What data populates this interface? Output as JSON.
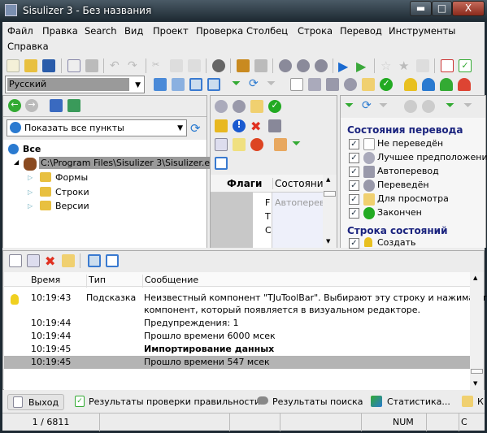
{
  "window": {
    "title": "Sisulizer 3 - Без названия",
    "minimize": "▬",
    "maximize": "□",
    "close": "X"
  },
  "menu": [
    "Файл",
    "Правка",
    "Search",
    "Вид",
    "Проект",
    "Проверка",
    "Столбец",
    "Строка",
    "Перевод",
    "Инструменты",
    "Справка"
  ],
  "language_combo": {
    "value": "Русский"
  },
  "project_tree": {
    "filter": "Показать все пункты",
    "root": "Все",
    "file": "C:\\Program Files\\Sisulizer 3\\Sisulizer.exe",
    "children": [
      "Формы",
      "Строки",
      "Версии"
    ]
  },
  "grid": {
    "headers": [
      "Флаги",
      "Состояние"
    ],
    "cells": [
      "F",
      "T",
      "C"
    ],
    "state_value": "Автоперевод"
  },
  "filter_panel": {
    "section1": "Состояния перевода",
    "states": [
      {
        "label": "Не переведён",
        "checked": true,
        "icon": "blank-page-icon"
      },
      {
        "label": "Лучшее предположение",
        "checked": true,
        "icon": "best-guess-icon"
      },
      {
        "label": "Автоперевод",
        "checked": true,
        "icon": "auto-translate-icon"
      },
      {
        "label": "Переведён",
        "checked": true,
        "icon": "gear-icon"
      },
      {
        "label": "Для просмотра",
        "checked": true,
        "icon": "review-icon"
      },
      {
        "label": "Закончен",
        "checked": true,
        "icon": "check-circle-icon"
      }
    ],
    "section2": "Строка состояний",
    "row_states": [
      {
        "label": "Создать",
        "checked": true,
        "icon": "yellow-pin-icon"
      }
    ]
  },
  "log": {
    "headers": [
      "Время",
      "Тип",
      "Сообщение"
    ],
    "rows": [
      {
        "time": "10:19:43",
        "type": "Подсказка",
        "message": "Неизвестный компонент \"TJuToolBar\". Выбирают эту строку и нажимают",
        "message2": "компонент, который появляется в визуальном редакторе.",
        "icon": "lightbulb-icon"
      },
      {
        "time": "10:19:44",
        "type": "",
        "message": "Предупреждения: 1"
      },
      {
        "time": "10:19:44",
        "type": "",
        "message": "Прошло времени 6000 мсек"
      },
      {
        "time": "10:19:45",
        "type": "",
        "message": "Импортирование данных",
        "bold": true
      },
      {
        "time": "10:19:45",
        "type": "",
        "message": "Прошло времени 547 мсек",
        "selected": true
      }
    ]
  },
  "tabs": [
    "Выход",
    "Результаты проверки правильности",
    "Результаты поиска",
    "Статистика...",
    "К"
  ],
  "status": {
    "position": "1 / 6811",
    "num": "NUM",
    "c": "C"
  },
  "colors": {
    "section": "#1a237e",
    "selected_row": "#b4b4b4"
  }
}
